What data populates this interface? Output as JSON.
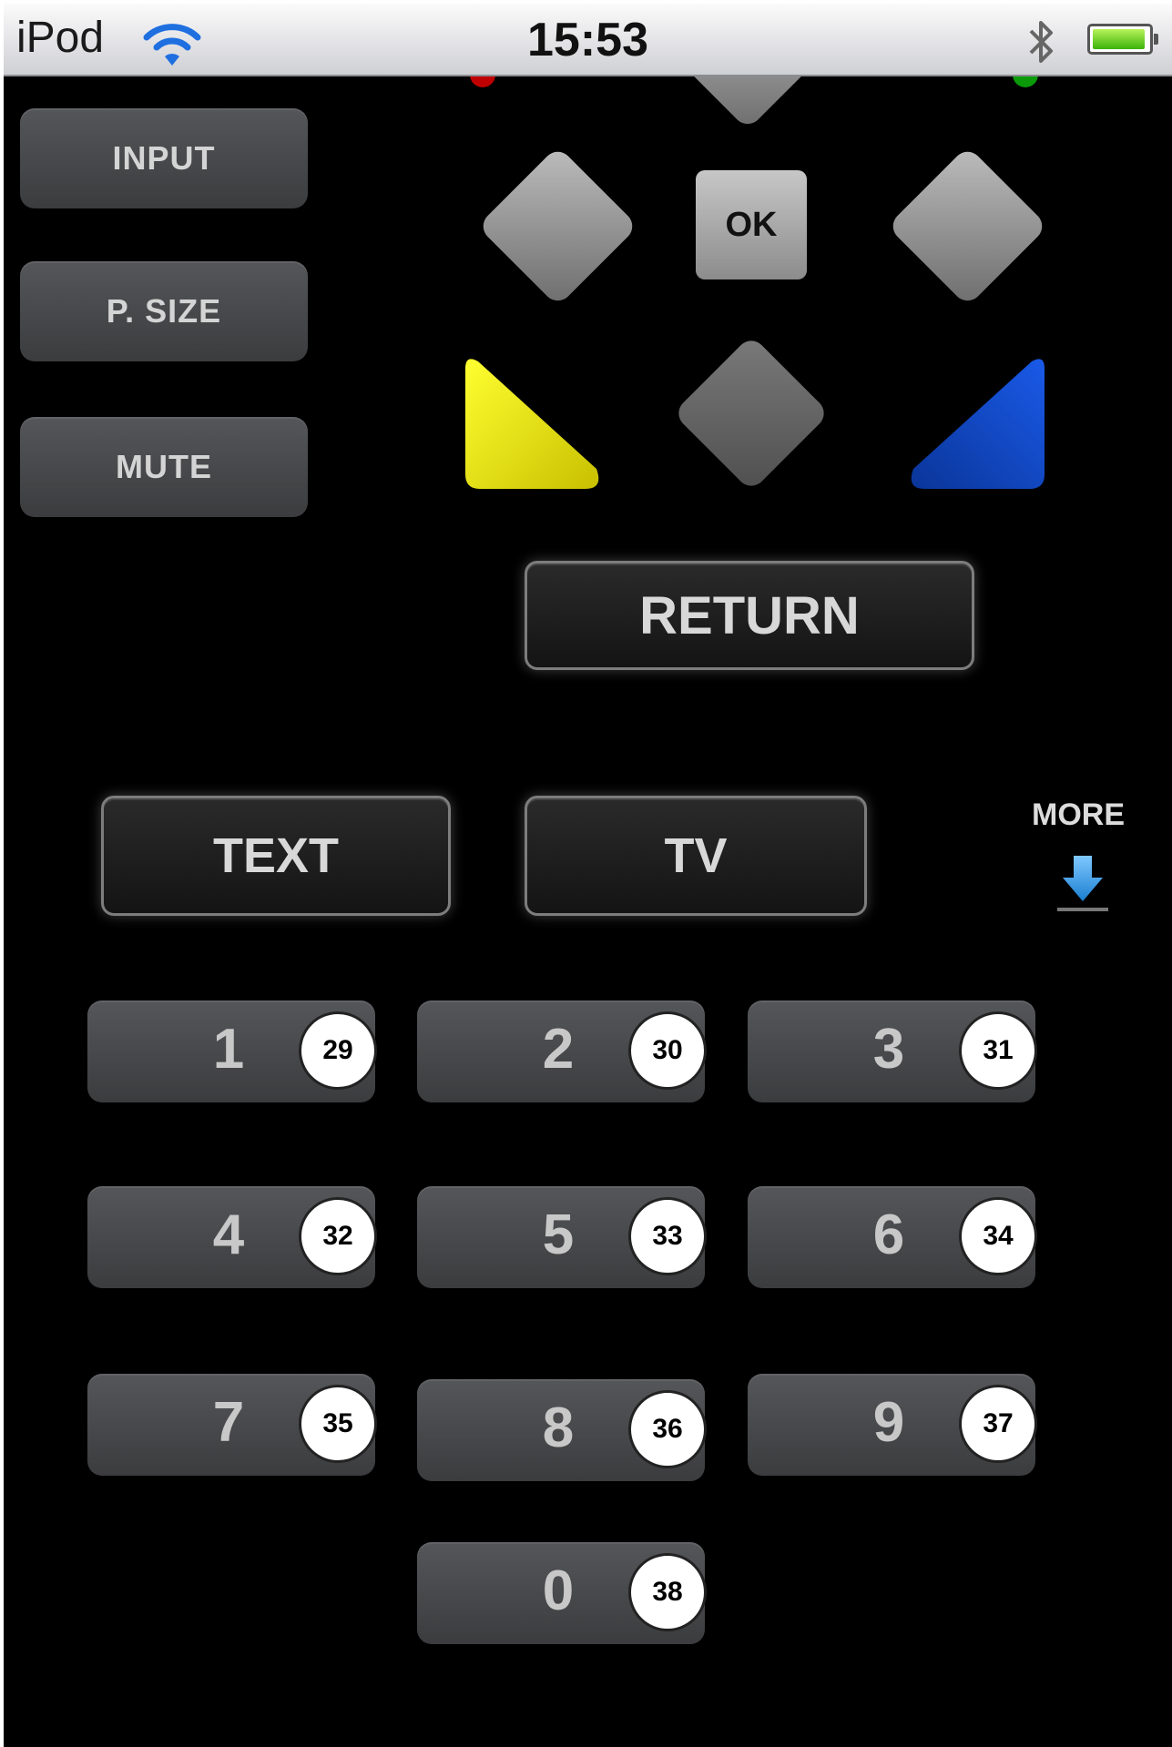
{
  "status_bar": {
    "device": "iPod",
    "time": "15:53",
    "icons": [
      "wifi-icon",
      "bluetooth-icon",
      "battery-icon"
    ],
    "battery_level": 0.95
  },
  "side_buttons": [
    "INPUT",
    "P. SIZE",
    "MUTE"
  ],
  "dpad": {
    "ok_label": "OK"
  },
  "color_keys": {
    "yellow": "#f5f000",
    "blue": "#0b3fc0",
    "red": "#c00000",
    "green": "#0a9a0a"
  },
  "return_label": "RETURN",
  "mode_buttons": {
    "text": "TEXT",
    "tv": "TV"
  },
  "more": {
    "label": "MORE",
    "icon": "arrow-down-icon"
  },
  "numpad": [
    {
      "num": "1",
      "badge": "29"
    },
    {
      "num": "2",
      "badge": "30"
    },
    {
      "num": "3",
      "badge": "31"
    },
    {
      "num": "4",
      "badge": "32"
    },
    {
      "num": "5",
      "badge": "33"
    },
    {
      "num": "6",
      "badge": "34"
    },
    {
      "num": "7",
      "badge": "35"
    },
    {
      "num": "8",
      "badge": "36"
    },
    {
      "num": "9",
      "badge": "37"
    },
    {
      "num": "0",
      "badge": "38"
    }
  ]
}
